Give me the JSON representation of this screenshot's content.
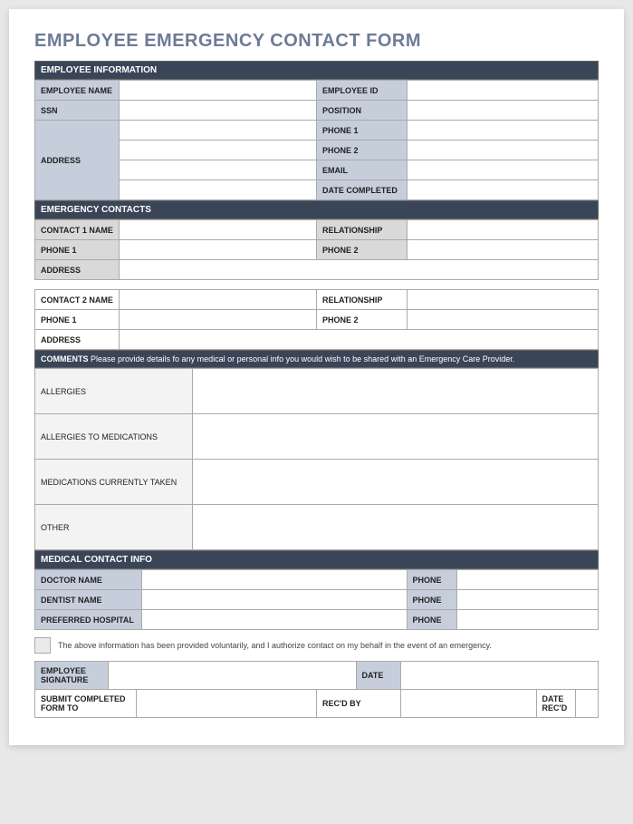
{
  "title": "EMPLOYEE EMERGENCY CONTACT FORM",
  "sections": {
    "employee_info": "EMPLOYEE INFORMATION",
    "emergency_contacts": "EMERGENCY CONTACTS",
    "medical_contact": "MEDICAL CONTACT INFO"
  },
  "employee": {
    "name_label": "EMPLOYEE NAME",
    "id_label": "EMPLOYEE ID",
    "ssn_label": "SSN",
    "position_label": "POSITION",
    "address_label": "ADDRESS",
    "phone1_label": "PHONE 1",
    "phone2_label": "PHONE 2",
    "email_label": "EMAIL",
    "date_completed_label": "DATE COMPLETED"
  },
  "contact1": {
    "name_label": "CONTACT 1 NAME",
    "relationship_label": "RELATIONSHIP",
    "phone1_label": "PHONE 1",
    "phone2_label": "PHONE 2",
    "address_label": "ADDRESS"
  },
  "contact2": {
    "name_label": "CONTACT 2 NAME",
    "relationship_label": "RELATIONSHIP",
    "phone1_label": "PHONE 1",
    "phone2_label": "PHONE 2",
    "address_label": "ADDRESS"
  },
  "comments": {
    "header_bold": "COMMENTS",
    "header_text": " Please provide details fo any medical or personal info you would wish to be shared with an Emergency Care Provider.",
    "allergies_label": "ALLERGIES",
    "allergies_meds_label": "ALLERGIES TO MEDICATIONS",
    "meds_taken_label": "MEDICATIONS CURRENTLY TAKEN",
    "other_label": "OTHER"
  },
  "medical": {
    "doctor_label": "DOCTOR NAME",
    "dentist_label": "DENTIST NAME",
    "hospital_label": "PREFERRED HOSPITAL",
    "phone_label": "PHONE"
  },
  "auth_text": "The above information has been provided voluntarily, and I authorize contact on my behalf in the event of an emergency.",
  "signature": {
    "employee_sig_label": "EMPLOYEE SIGNATURE",
    "date_label": "DATE",
    "submit_label": "SUBMIT COMPLETED FORM TO",
    "recd_by_label": "REC'D BY",
    "date_recd_label": "DATE REC'D"
  }
}
